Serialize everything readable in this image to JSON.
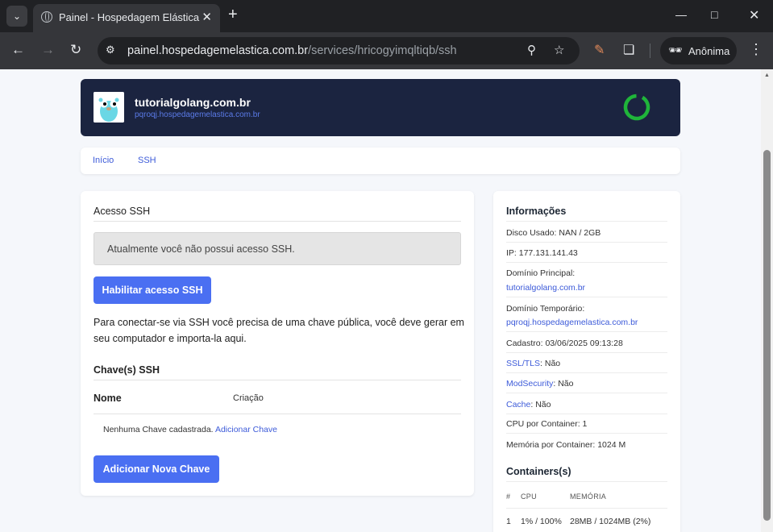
{
  "browser": {
    "tab_title": "Painel - Hospedagem Elástica",
    "url_host": "painel.hospedagemelastica.com.br",
    "url_path": "/services/hricogyimqltiqb/ssh",
    "profile_label": "Anônima"
  },
  "header": {
    "site_name": "tutorialgolang.com.br",
    "temp_domain": "pqroqj.hospedagemelastica.com.br",
    "status_color": "#1fb53a"
  },
  "breadcrumb": {
    "items": [
      "Início",
      "SSH"
    ]
  },
  "ssh": {
    "title": "Acesso SSH",
    "notice": "Atualmente você não possui acesso SSH.",
    "enable_button": "Habilitar acesso SSH",
    "info_line1": "Para conectar-se via SSH você precisa de uma chave pública, você deve gerar em",
    "info_line2": "seu computador e importa-la aqui.",
    "keys_title": "Chave(s) SSH",
    "col_name": "Nome",
    "col_created": "Criação",
    "empty_text": "Nenhuma Chave cadastrada.",
    "add_key_link": "Adicionar Chave",
    "add_button": "Adicionar Nova Chave"
  },
  "info": {
    "title": "Informações",
    "disk": "Disco Usado: NAN / 2GB",
    "ip": "IP: 177.131.141.43",
    "main_domain_label": "Domínio Principal:",
    "main_domain": "tutorialgolang.com.br",
    "temp_domain_label": "Domínio Temporário:",
    "temp_domain": "pqroqj.hospedagemelastica.com.br",
    "created": "Cadastro: 03/06/2025 09:13:28",
    "ssl_label": "SSL/TLS",
    "ssl_value": ": Não",
    "modsec_label": "ModSecurity",
    "modsec_value": ": Não",
    "cache_label": "Cache",
    "cache_value": ": Não",
    "cpu": "CPU por Container: 1",
    "memory": "Memória por Container: 1024 M",
    "containers_title": "Containers(s)",
    "col_hash": "#",
    "col_cpu": "CPU",
    "col_mem": "MEMÓRIA",
    "row_id": "1",
    "row_cpu": "1% / 100%",
    "row_mem": "28MB / 1024MB (2%)"
  }
}
